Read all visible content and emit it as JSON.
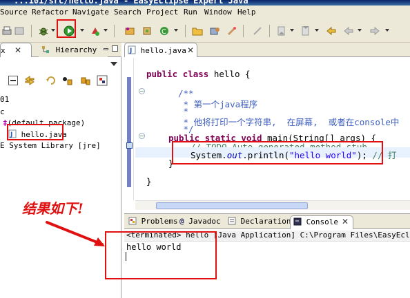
{
  "window": {
    "title": "...101/src/hello.java - EasyEclipse Expert Java"
  },
  "menu": [
    "Source",
    "Refactor",
    "Navigate",
    "Search",
    "Project",
    "Run",
    "Window",
    "Help"
  ],
  "toolbar": {
    "icons": [
      "print-icon",
      "debug-icon",
      "run-icon",
      "external-tools-icon",
      "new-package-icon",
      "new-class-icon",
      "open-type-icon",
      "open-resource-icon",
      "search-icon",
      "next-annotation-icon",
      "prev-annotation-icon",
      "last-edit-icon",
      "back-icon",
      "forward-icon"
    ]
  },
  "left_pane": {
    "tabs": [
      {
        "label": "x",
        "active": true
      },
      {
        "label": "Hierarchy",
        "active": false
      }
    ],
    "tree": [
      {
        "label": "01"
      },
      {
        "label": "c"
      },
      {
        "label": "(default package)"
      },
      {
        "label": "hello.java"
      },
      {
        "label": "E System Library [jre]"
      }
    ]
  },
  "editor": {
    "tab_label": "hello.java",
    "lines": {
      "class_decl_kw1": "public",
      "class_decl_kw2": "class",
      "class_decl_name": " hello {",
      "doc_open": "/**",
      "doc_line1": " * 第一个java程序",
      "doc_line2": " *",
      "doc_line3": " * 他将打印一个字符串,  在屏幕,  或者在console中",
      "doc_close": " */",
      "method_kw1": "public",
      "method_kw2": "static",
      "method_kw3": "void",
      "method_sig": " main(String[] args) {",
      "todo_comment": "// TODO Auto-generated method stub",
      "print_a": "System.",
      "print_b": "out",
      "print_c": ".println(",
      "print_str": "\"hello world\"",
      "print_d": ");",
      "print_tail": " // 打",
      "close_method": "}",
      "close_class": "}"
    }
  },
  "console_view": {
    "tabs": [
      "Problems",
      "Javadoc",
      "Declaration",
      "Console"
    ],
    "active_tab": "Console",
    "status": "<terminated> hello [Java Application] C:\\Program Files\\EasyEclipse Ex",
    "output": "hello world"
  },
  "annotation": {
    "text": "结果如下!",
    "color": "#e01010"
  },
  "colors": {
    "keyword": "#7f0055",
    "javadoc": "#3f5fbf",
    "comment": "#3f7f5f",
    "string": "#2a00ff",
    "static_field": "#0000c0",
    "chrome": "#ece9d8"
  }
}
